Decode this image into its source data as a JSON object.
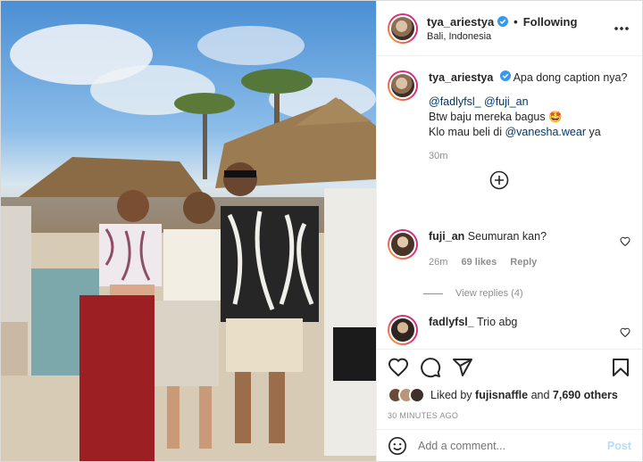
{
  "header": {
    "username": "tya_ariestya",
    "follow_label": "Following",
    "location": "Bali, Indonesia",
    "separator": "•"
  },
  "caption": {
    "username": "tya_ariestya",
    "text": "Apa dong caption nya?",
    "mention_line_1": "@fadlyfsl_",
    "mention_line_2": "@fuji_an",
    "line_2": "Btw baju mereka bagus 🤩",
    "line_3_prefix": "Klo mau beli di",
    "line_3_mention": "@vanesha.wear",
    "line_3_suffix": "ya",
    "time": "30m"
  },
  "comments": [
    {
      "username": "fuji_an",
      "text": "Seumuran kan?",
      "time": "26m",
      "likes": "69 likes",
      "reply_label": "Reply",
      "view_replies": "View replies (4)"
    },
    {
      "username": "fadlyfsl_",
      "text": "Trio abg"
    }
  ],
  "likes": {
    "prefix": "Liked by",
    "user": "fujisnaffle",
    "suffix": "and",
    "count": "7,690 others"
  },
  "timestamp": "30 MINUTES AGO",
  "add_comment": {
    "placeholder": "Add a comment...",
    "post_label": "Post"
  },
  "colors": {
    "verified": "#3897f0",
    "link": "#00376b",
    "muted": "#8e8e8e",
    "post_disabled": "#b2dffc"
  },
  "icons": [
    "verified-badge-icon",
    "more-options-icon",
    "add-circle-icon",
    "heart-icon",
    "comment-icon",
    "share-icon",
    "bookmark-icon",
    "emoji-icon"
  ]
}
